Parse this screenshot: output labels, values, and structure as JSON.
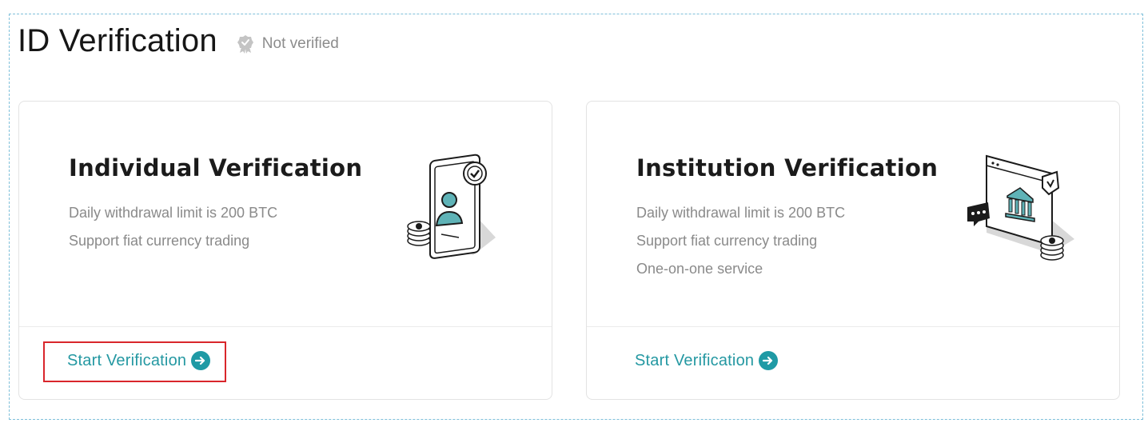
{
  "header": {
    "title": "ID Verification",
    "status_text": "Not verified",
    "status_icon": "badge-check-icon"
  },
  "cards": [
    {
      "title": "Individual Verification",
      "features": [
        "Daily withdrawal limit is 200 BTC",
        "Support fiat currency trading"
      ],
      "cta_label": "Start Verification",
      "illustration": "phone-user-id-illustration",
      "highlighted": true
    },
    {
      "title": "Institution Verification",
      "features": [
        "Daily withdrawal limit is 200 BTC",
        "Support fiat currency trading",
        "One-on-one service"
      ],
      "cta_label": "Start Verification",
      "illustration": "bank-institution-illustration",
      "highlighted": false
    }
  ],
  "colors": {
    "accent": "#1f9aa5",
    "highlight_border": "#d9262b",
    "frame_border": "#7fc0da"
  }
}
